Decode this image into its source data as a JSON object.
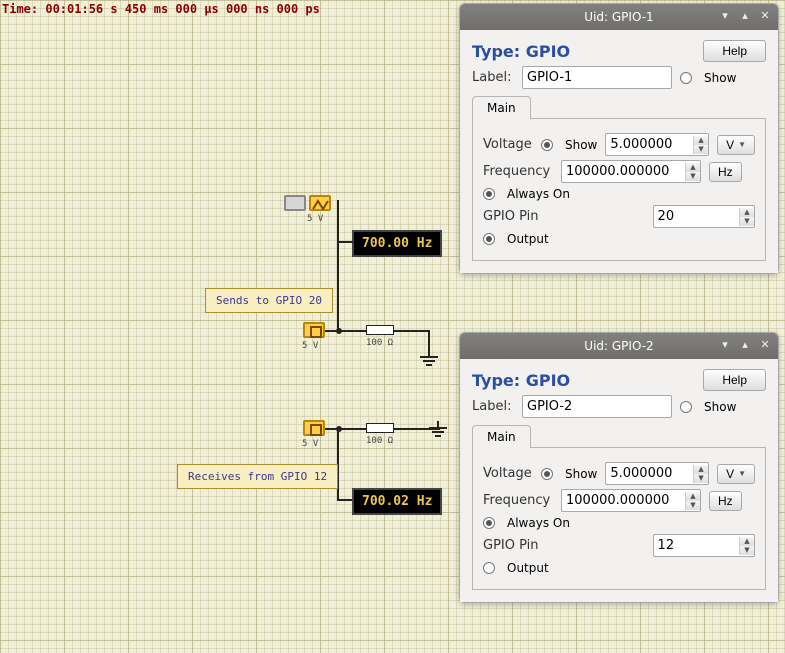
{
  "time_label": "Time: 00:01:56 s  450 ms  000 µs  000 ns  000 ps",
  "diagram": {
    "osc_label": "5 V",
    "gpio1_label": "5 V",
    "gpio2_label": "5 V",
    "res1_label": "100 Ω",
    "res2_label": "100 Ω",
    "freq1": "700.00  Hz",
    "freq2": "700.02  Hz",
    "note1": "Sends to GPIO 20",
    "note2": "Receives from GPIO 12"
  },
  "panel1": {
    "title": "Uid: GPIO-1",
    "type": "Type: GPIO",
    "help": "Help",
    "label_caption": "Label:",
    "label_value": "GPIO-1",
    "show": "Show",
    "tab_main": "Main",
    "voltage_caption": "Voltage",
    "voltage_show": "Show",
    "voltage_value": "5.000000",
    "voltage_unit": "V",
    "freq_caption": "Frequency",
    "freq_value": "100000.000000",
    "freq_unit": "Hz",
    "always_on": "Always On",
    "gpio_pin_caption": "GPIO Pin",
    "gpio_pin_value": "20",
    "output": "Output"
  },
  "panel2": {
    "title": "Uid: GPIO-2",
    "type": "Type: GPIO",
    "help": "Help",
    "label_caption": "Label:",
    "label_value": "GPIO-2",
    "show": "Show",
    "tab_main": "Main",
    "voltage_caption": "Voltage",
    "voltage_show": "Show",
    "voltage_value": "5.000000",
    "voltage_unit": "V",
    "freq_caption": "Frequency",
    "freq_value": "100000.000000",
    "freq_unit": "Hz",
    "always_on": "Always On",
    "gpio_pin_caption": "GPIO Pin",
    "gpio_pin_value": "12",
    "output": "Output"
  }
}
